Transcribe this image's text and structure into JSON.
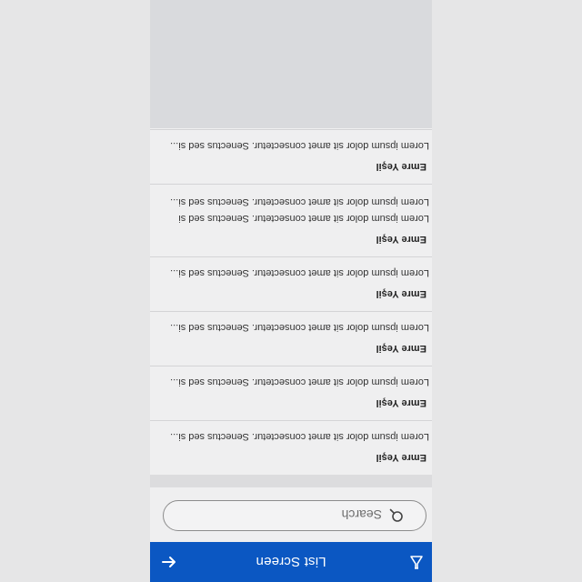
{
  "app_bar": {
    "title": "List Screen",
    "back_icon": "arrow-left-icon",
    "action_icon": "flask-icon",
    "color": "#0b57c2"
  },
  "search": {
    "placeholder": "Search",
    "icon": "search-icon"
  },
  "items": [
    {
      "name": "Emre Yeşil",
      "lines": [
        "Lorem ipsum dolor sit amet consectetur. Senectus sed si..."
      ]
    },
    {
      "name": "Emre Yeşil",
      "lines": [
        "Lorem ipsum dolor sit amet consectetur. Senectus sed si..."
      ]
    },
    {
      "name": "Emre Yeşil",
      "lines": [
        "Lorem ipsum dolor sit amet consectetur. Senectus sed si..."
      ]
    },
    {
      "name": "Emre Yeşil",
      "lines": [
        "Lorem ipsum dolor sit amet consectetur. Senectus sed si..."
      ]
    },
    {
      "name": "Emre Yeşil",
      "lines": [
        "Lorem ipsum dolor sit amet consectetur. Senectus sed si",
        "Lorem ipsum dolor sit amet consectetur. Senectus sed si..."
      ]
    },
    {
      "name": "Emre Yeşil",
      "lines": [
        "Lorem ipsum dolor sit amet consectetur. Senectus sed si..."
      ]
    }
  ]
}
